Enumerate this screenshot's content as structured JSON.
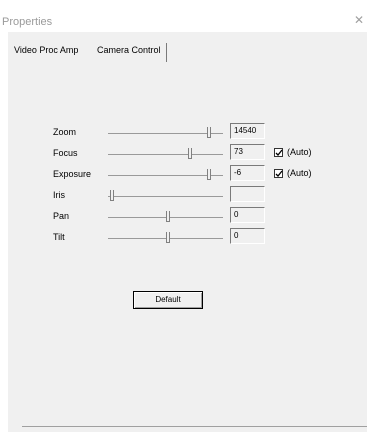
{
  "window": {
    "title": "Properties",
    "close_glyph": "✕"
  },
  "tabs": [
    {
      "label": "Video Proc Amp",
      "selected": false
    },
    {
      "label": "Camera Control",
      "selected": true
    }
  ],
  "controls": [
    {
      "label": "Zoom",
      "value": "14540",
      "slider_level": 0.87,
      "auto_checked": null
    },
    {
      "label": "Focus",
      "value": "73",
      "slider_level": 0.7,
      "auto_checked": true
    },
    {
      "label": "Exposure",
      "value": "-6",
      "slider_level": 0.87,
      "auto_checked": true
    },
    {
      "label": "Iris",
      "value": "",
      "slider_level": 0.0,
      "auto_checked": null
    },
    {
      "label": "Pan",
      "value": "0",
      "slider_level": 0.5,
      "auto_checked": null
    },
    {
      "label": "Tilt",
      "value": "0",
      "slider_level": 0.5,
      "auto_checked": null
    }
  ],
  "auto_label": "(Auto)",
  "default_button": "Default"
}
